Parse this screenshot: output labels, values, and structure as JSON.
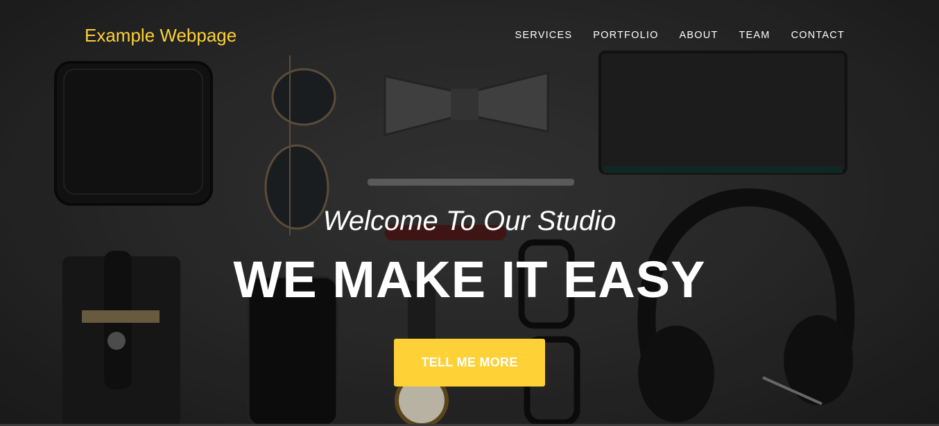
{
  "navbar": {
    "brand": "Example Webpage",
    "links": [
      {
        "label": "SERVICES"
      },
      {
        "label": "PORTFOLIO"
      },
      {
        "label": "ABOUT"
      },
      {
        "label": "TEAM"
      },
      {
        "label": "CONTACT"
      }
    ]
  },
  "intro": {
    "lead_in": "Welcome To Our Studio",
    "heading": "WE MAKE IT EASY",
    "cta_label": "TELL ME MORE"
  },
  "colors": {
    "accent": "#fed136",
    "text": "#ffffff",
    "background": "#2f2f2f"
  }
}
